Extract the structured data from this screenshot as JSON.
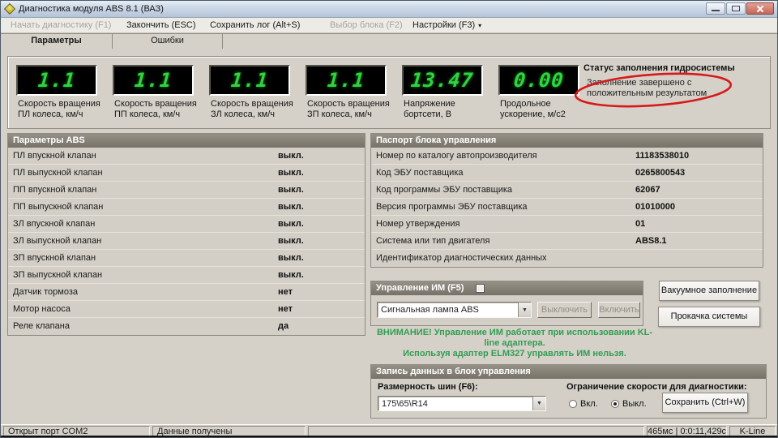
{
  "window": {
    "title": "Диагностика модуля ABS 8.1 (ВАЗ)"
  },
  "menu": {
    "items": [
      {
        "label": "Начать диагностику (F1)",
        "enabled": false
      },
      {
        "label": "Закончить (ESC)",
        "enabled": true
      },
      {
        "label": "Сохранить лог (Alt+S)",
        "enabled": true
      },
      {
        "label": "Выбор блока (F2)",
        "enabled": false
      },
      {
        "label": "Настройки (F3)",
        "enabled": true
      }
    ]
  },
  "tabs": [
    {
      "label": "Параметры",
      "active": true
    },
    {
      "label": "Ошибки",
      "active": false
    }
  ],
  "gauges": {
    "items": [
      {
        "value": "1.1",
        "label": "Скорость вращения ПЛ колеса, км/ч"
      },
      {
        "value": "1.1",
        "label": "Скорость вращения ПП колеса, км/ч"
      },
      {
        "value": "1.1",
        "label": "Скорость вращения ЗЛ колеса, км/ч"
      },
      {
        "value": "1.1",
        "label": "Скорость вращения ЗП колеса, км/ч"
      },
      {
        "value": "13.47",
        "label": "Напряжение бортсети, В"
      },
      {
        "value": "0.00",
        "label": "Продольное ускорение, м/с2"
      }
    ],
    "hydro_status": {
      "title": "Статус заполнения гидросистемы",
      "text": "Заполнение завершено с положительным результатом"
    }
  },
  "abs_params": {
    "title": "Параметры ABS",
    "rows": [
      {
        "label": "ПЛ впускной клапан",
        "value": "выкл."
      },
      {
        "label": "ПЛ выпускной клапан",
        "value": "выкл."
      },
      {
        "label": "ПП впускной клапан",
        "value": "выкл."
      },
      {
        "label": "ПП выпускной клапан",
        "value": "выкл."
      },
      {
        "label": "ЗЛ впускной клапан",
        "value": "выкл."
      },
      {
        "label": "ЗЛ выпускной клапан",
        "value": "выкл."
      },
      {
        "label": "ЗП впускной клапан",
        "value": "выкл."
      },
      {
        "label": "ЗП выпускной клапан",
        "value": "выкл."
      },
      {
        "label": "Датчик тормоза",
        "value": "нет"
      },
      {
        "label": "Мотор насоса",
        "value": "нет"
      },
      {
        "label": "Реле клапана",
        "value": "да"
      }
    ]
  },
  "passport": {
    "title": "Паспорт блока управления",
    "rows": [
      {
        "label": "Номер по каталогу автопроизводителя",
        "value": "11183538010"
      },
      {
        "label": "Код ЭБУ поставщика",
        "value": "0265800543"
      },
      {
        "label": "Код программы ЭБУ поставщика",
        "value": "62067"
      },
      {
        "label": "Версия программы ЭБУ поставщика",
        "value": "01010000"
      },
      {
        "label": "Номер утверждения",
        "value": "01"
      },
      {
        "label": "Система или тип двигателя",
        "value": "ABS8.1"
      },
      {
        "label": "Идентификатор диагностических данных",
        "value": ""
      }
    ]
  },
  "im_control": {
    "title": "Управление ИМ (F5)",
    "combo_value": "Сигнальная лампа ABS",
    "off_button": "Выключить",
    "on_button": "Включить"
  },
  "im_warning": {
    "line1": "ВНИМАНИЕ! Управление ИМ работает при использовании KL-line адаптера.",
    "line2": "Используя адаптер ELM327 управлять ИМ нельзя."
  },
  "actions": {
    "vacuum_fill": "Вакуумное заполнение",
    "system_bleed": "Прокачка системы"
  },
  "write_block": {
    "title": "Запись данных в блок управления",
    "tire_size_label": "Размерность шин (F6):",
    "tire_size_value": "175\\65\\R14",
    "speed_limit_label": "Ограничение скорости для диагностики:",
    "radio_on": "Вкл.",
    "radio_off": "Выкл.",
    "save_button": "Сохранить  (Ctrl+W)"
  },
  "statusbar": {
    "port": "Открыт порт COM2",
    "data_state": "Данные получены",
    "timing": "465мс | 0:0:11,429с",
    "protocol": "K-Line"
  },
  "colors": {
    "lcd_digits": "#2ed53e",
    "warning_text": "#2f9e50",
    "annotation_ellipse": "#d61a1a",
    "panel_header": "#7b776d",
    "background": "#d5d1c9"
  }
}
